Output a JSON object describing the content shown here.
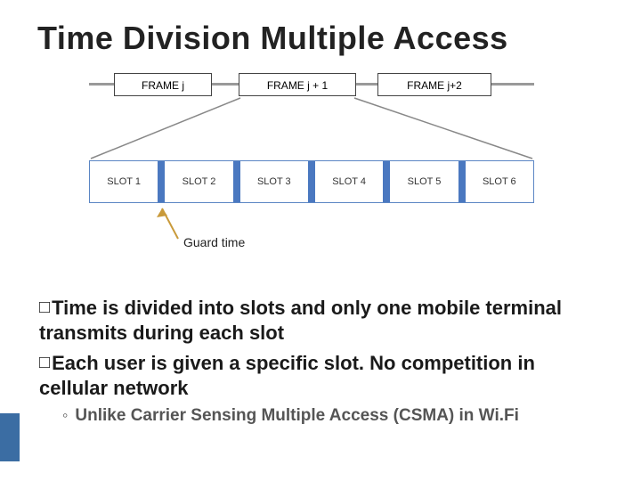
{
  "title": "Time Division Multiple Access",
  "figure": {
    "frames": [
      "FRAME  j",
      "FRAME  j + 1",
      "FRAME   j+2"
    ],
    "slots": [
      "SLOT 1",
      "SLOT 2",
      "SLOT 3",
      "SLOT 4",
      "SLOT 5",
      "SLOT 6"
    ],
    "guard_arrow_label": "Guard time"
  },
  "bullets": {
    "b1_lead": "Time",
    "b1_rest": " is divided into slots and only one mobile terminal transmits during each slot",
    "b2_lead": "Each",
    "b2_rest": " user is given a specific slot. No competition in cellular network",
    "sub1": "Unlike Carrier Sensing Multiple Access (CSMA) in Wi.Fi"
  },
  "symbols": {
    "square": "□",
    "ring": "◦"
  }
}
